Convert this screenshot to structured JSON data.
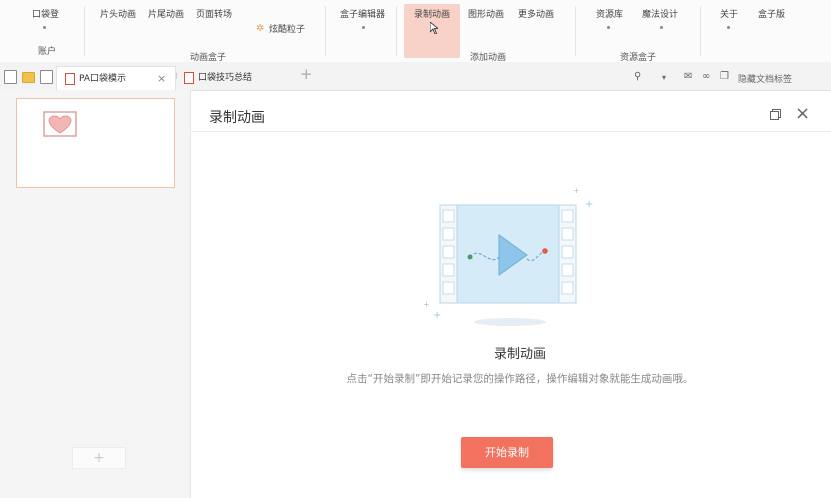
{
  "ribbon": {
    "items": {
      "pocket_login": "口袋登",
      "account": "账户",
      "intro_anim": "片头动画",
      "outro_anim": "片尾动画",
      "page_transition": "页面转场",
      "particle": "炫酷粒子",
      "box_editor": "盒子编辑器",
      "record_anim": "录制动画",
      "path_anim": "图形动画",
      "more_anim": "更多动画",
      "resource_lib": "资源库",
      "magic_design": "魔法设计",
      "about": "关于",
      "box_version": "盒子版"
    },
    "groups": {
      "anim_box": "动画盒子",
      "add_anim": "添加动画",
      "resource_box": "资源盒子"
    }
  },
  "tabs": [
    {
      "label": "PA口袋模示"
    },
    {
      "label": "口袋技巧总结"
    }
  ],
  "tabbar_right": {
    "hide_label": "隐藏文档标签"
  },
  "panel": {
    "title": "录制动画",
    "heading": "录制动画",
    "description": "点击“开始录制”即开始记录您的操作路径，操作编辑对象就能生成动画哦。",
    "start_button": "开始录制"
  },
  "colors": {
    "accent": "#f2725f",
    "active_ribbon": "#f8d2c8",
    "film_blue": "#d6ebf8"
  }
}
